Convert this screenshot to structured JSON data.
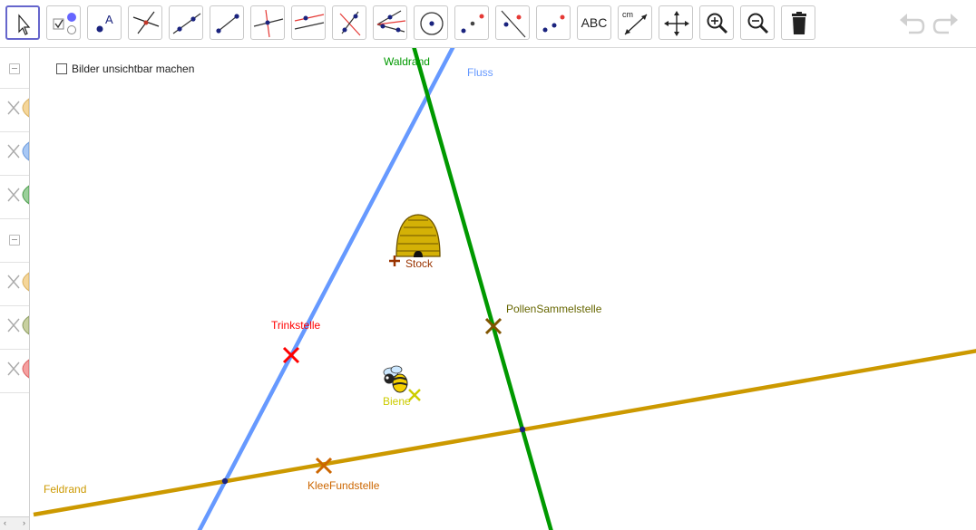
{
  "toolbar": {
    "tools": [
      {
        "name": "move-tool",
        "icon": "cursor-arrow-icon",
        "active": true
      },
      {
        "name": "checkbox-tool",
        "icon": "checkbox-radio-icon"
      },
      {
        "name": "point-tool",
        "icon": "point-label-icon",
        "text": "A"
      },
      {
        "name": "intersect-tool",
        "icon": "intersect-icon"
      },
      {
        "name": "line-tool",
        "icon": "line-icon"
      },
      {
        "name": "segment-tool",
        "icon": "segment-icon"
      },
      {
        "name": "perpendicular-tool",
        "icon": "perpendicular-icon"
      },
      {
        "name": "parallel-tool",
        "icon": "parallel-icon"
      },
      {
        "name": "bisector-tool",
        "icon": "bisector-icon"
      },
      {
        "name": "angle-bisector-tool",
        "icon": "angle-bisector-icon"
      },
      {
        "name": "circle-tool",
        "icon": "circle-center-icon"
      },
      {
        "name": "reflect-point-tool",
        "icon": "reflect-point-icon"
      },
      {
        "name": "reflect-line-tool",
        "icon": "reflect-line-icon"
      },
      {
        "name": "translate-tool",
        "icon": "translate-icon"
      },
      {
        "name": "text-tool",
        "icon": "text-icon",
        "text": "ABC"
      },
      {
        "name": "distance-tool",
        "icon": "distance-icon",
        "text": "cm"
      },
      {
        "name": "move-view-tool",
        "icon": "move-view-icon"
      },
      {
        "name": "zoom-in-tool",
        "icon": "zoom-in-icon"
      },
      {
        "name": "zoom-out-tool",
        "icon": "zoom-out-icon"
      },
      {
        "name": "delete-tool",
        "icon": "trash-icon"
      }
    ],
    "undo_icon": "undo-icon",
    "redo_icon": "redo-icon"
  },
  "sidebar": {
    "rows": [
      {
        "type": "collapse",
        "icon": "collapse-icon"
      },
      {
        "type": "item",
        "color": "#f5d69a",
        "icon": "image-visibility-icon"
      },
      {
        "type": "item",
        "color": "#a8c8f5",
        "icon": "image-visibility-icon"
      },
      {
        "type": "item",
        "color": "#9ad09a",
        "icon": "image-visibility-icon"
      },
      {
        "type": "collapse",
        "icon": "collapse-icon"
      },
      {
        "type": "item",
        "color": "#f5d69a",
        "icon": "image-visibility-icon"
      },
      {
        "type": "item",
        "color": "#c8d0a0",
        "icon": "image-visibility-icon"
      },
      {
        "type": "item",
        "color": "#f5a0a0",
        "icon": "image-visibility-icon"
      }
    ]
  },
  "canvas": {
    "checkbox_label": "Bilder unsichtbar machen",
    "checkbox_checked": false,
    "lines": {
      "waldrand": {
        "label": "Waldrand",
        "color": "#009900"
      },
      "fluss": {
        "label": "Fluss",
        "color": "#6699ff"
      },
      "feldrand": {
        "label": "Feldrand",
        "color": "#cc9900"
      }
    },
    "points": {
      "stock": {
        "label": "Stock",
        "color": "#993300",
        "icon": "beehive-icon"
      },
      "pollen": {
        "label": "PollenSammelstelle",
        "color": "#666600"
      },
      "trink": {
        "label": "Trinkstelle",
        "color": "#ff0000"
      },
      "biene": {
        "label": "Biene",
        "color": "#cccc00",
        "icon": "bee-icon"
      },
      "klee": {
        "label": "KleeFundstelle",
        "color": "#cc6600"
      }
    }
  }
}
